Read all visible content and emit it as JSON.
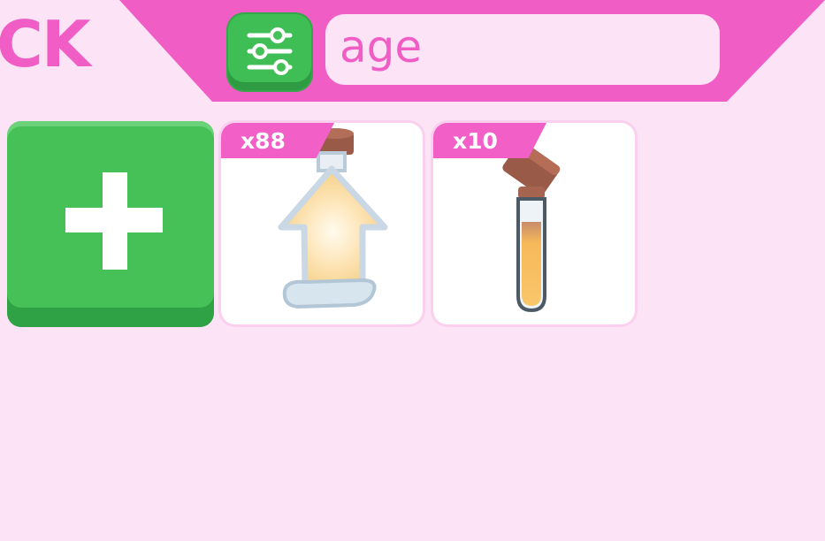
{
  "header": {
    "title": "CK",
    "accent_color": "#f05dc4",
    "filter_icon": "sliders-icon"
  },
  "search": {
    "value": "age"
  },
  "add_button": {
    "icon": "plus-icon",
    "color": "#45c157"
  },
  "items": [
    {
      "count": "x88",
      "icon": "arrow-potion-bottle-icon"
    },
    {
      "count": "x10",
      "icon": "test-tube-potion-icon"
    }
  ]
}
